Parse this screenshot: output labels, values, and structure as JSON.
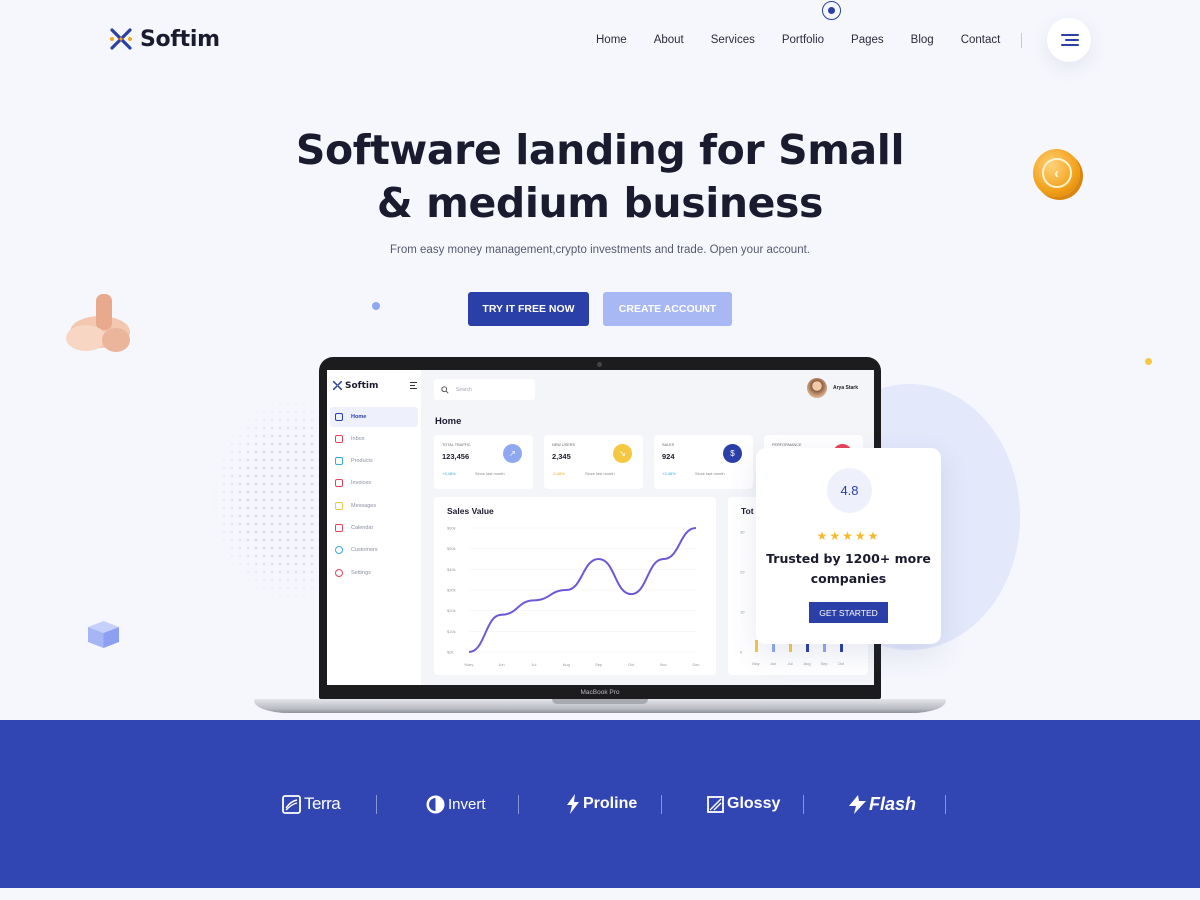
{
  "header": {
    "logo_text": "Softim",
    "nav": [
      "Home",
      "About",
      "Services",
      "Portfolio",
      "Pages",
      "Blog",
      "Contact"
    ]
  },
  "hero": {
    "title_line1": "Software landing for Small",
    "title_line2": "& medium business",
    "subtitle": "From easy money management,crypto investments and trade. Open your account.",
    "primary_cta": "TRY IT FREE NOW",
    "secondary_cta": "CREATE ACCOUNT"
  },
  "laptop": {
    "model_label": "MacBook Pro",
    "dashboard": {
      "logo_text": "Softim",
      "sidebar": [
        "Home",
        "Inbox",
        "Products",
        "Invoices",
        "Messages",
        "Calendar",
        "Customers",
        "Settings"
      ],
      "search_placeholder": "Search",
      "user_name": "Arya Stark",
      "page_title": "Home",
      "cards": [
        {
          "label": "TOTAL TRAFFIC",
          "value": "123,456",
          "change": "+3.48%",
          "since": "Since last month",
          "icon": "trend-up-icon",
          "color": "#8fa8f0"
        },
        {
          "label": "NEW USERS",
          "value": "2,345",
          "change": "-3.48%",
          "since": "Since last month",
          "icon": "trend-down-icon",
          "color": "#f5c842"
        },
        {
          "label": "SALES",
          "value": "924",
          "change": "+3.48%",
          "since": "Since last month",
          "icon": "dollar-icon",
          "color": "#2b3fa8"
        },
        {
          "label": "PERFORMANCE",
          "icon": "performance-icon",
          "color": "#e8425a"
        }
      ],
      "sales_panel_title": "Sales Value",
      "total_panel_title": "Tot"
    }
  },
  "chart_data": [
    {
      "type": "line",
      "title": "Sales Value",
      "x": [
        "Mary",
        "Jun",
        "Jul",
        "Aug",
        "Sep",
        "Oct",
        "Nov",
        "Dec"
      ],
      "y_ticks": [
        "$60k",
        "$50k",
        "$40k",
        "$30k",
        "$20k",
        "$10k",
        "$0k"
      ],
      "ylim": [
        0,
        60
      ],
      "series": [
        {
          "values": [
            0,
            18,
            25,
            30,
            45,
            28,
            45,
            60
          ]
        }
      ]
    },
    {
      "type": "bar",
      "title": "Tot",
      "categories": [
        "May",
        "Jun",
        "Jul",
        "Aug",
        "Sep",
        "Oct"
      ],
      "y_ticks": [
        "30",
        "20",
        "10",
        "0"
      ],
      "ylim": [
        0,
        30
      ],
      "colors": [
        "#f5c842",
        "#8fa8f0",
        "#f5c842",
        "#2b3fa8",
        "#8fa8f0",
        "#2b3fa8"
      ]
    }
  ],
  "rating_card": {
    "score": "4.8",
    "stars": "★★★★★",
    "text_line1": "Trusted by 1200+ more",
    "text_line2": "companies",
    "cta": "GET STARTED"
  },
  "brands": [
    "Terra",
    "Invert",
    "Proline",
    "Glossy",
    "Flash"
  ],
  "colors": {
    "primary": "#2b3fa8",
    "secondary": "#a7b8f5",
    "accent": "#f5b82e",
    "band": "#3246b3",
    "background": "#f6f7fd"
  }
}
